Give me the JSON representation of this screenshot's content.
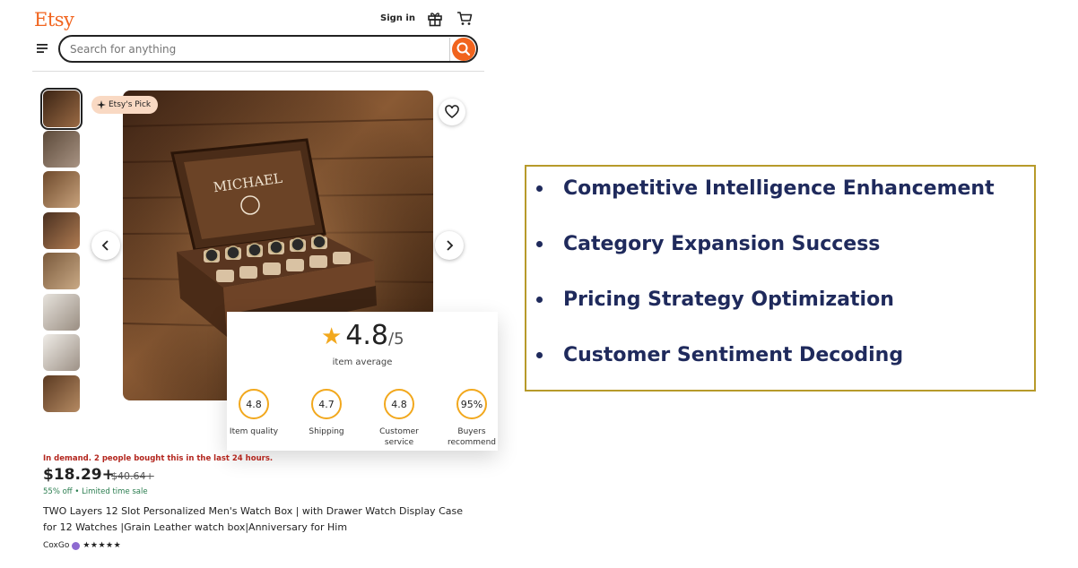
{
  "header": {
    "logo": "Etsy",
    "sign_in": "Sign in",
    "search_placeholder": "Search for anything"
  },
  "icons": {
    "gift": "gift-icon",
    "cart": "cart-icon",
    "menu": "menu-icon",
    "search": "search-icon",
    "heart": "heart-icon",
    "prev": "chevron-left-icon",
    "next": "chevron-right-icon"
  },
  "product": {
    "badge": "Etsy's Pick",
    "demand": "In demand. 2 people bought this in the last 24 hours.",
    "price": "$18.29+",
    "original_price": "$40.64+",
    "sale": "55% off  •  Limited time sale",
    "title": "TWO Layers 12 Slot Personalized Men's Watch Box | with Drawer Watch Display Case for 12 Watches |Grain Leather watch box|Anniversary for Him",
    "seller": "CoxGo",
    "seller_stars": "★★★★★",
    "thumbnail_count": 8
  },
  "rating": {
    "value": "4.8",
    "out_of": "/5",
    "caption": "item average",
    "breakdown": [
      {
        "value": "4.8",
        "label": "Item quality"
      },
      {
        "value": "4.7",
        "label": "Shipping"
      },
      {
        "value": "4.8",
        "label": "Customer service"
      },
      {
        "value": "95%",
        "label": "Buyers recommend"
      }
    ]
  },
  "highlights": [
    "Competitive Intelligence Enhancement",
    "Category Expansion Success",
    "Pricing Strategy Optimization",
    "Customer Sentiment Decoding"
  ],
  "colors": {
    "brand": "#f1641e",
    "accent_star": "#f2a81d",
    "highlight_text": "#1f2a5c",
    "box_border": "#b79a2a",
    "demand_text": "#b3261e",
    "sale_text": "#2a7d4f"
  }
}
